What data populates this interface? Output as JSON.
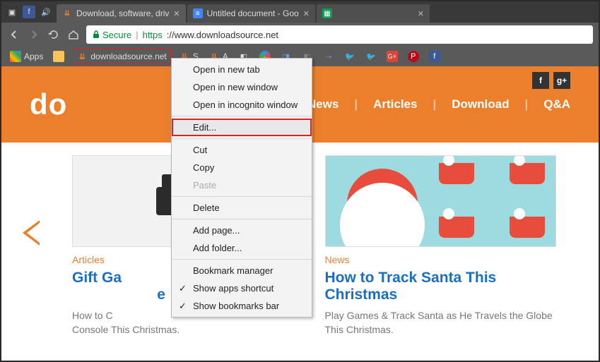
{
  "tabs": [
    {
      "title": "Download, software, driv",
      "icon": "ds"
    },
    {
      "title": "Untitled document - Goo",
      "icon": "doc"
    },
    {
      "title": "",
      "icon": "sheet"
    }
  ],
  "nav": {
    "secure_label": "Secure",
    "url_proto": "https",
    "url_rest": "://www.downloadsource.net"
  },
  "bookmarks": {
    "apps_label": "Apps",
    "highlighted": {
      "label": "downloadsource.net"
    },
    "items": [
      {
        "icon": "ds",
        "label": "S"
      },
      {
        "icon": "ds",
        "label": "A"
      },
      {
        "icon": "g",
        "label": ""
      },
      {
        "icon": "tw",
        "label": ""
      },
      {
        "icon": "tw",
        "label": ""
      },
      {
        "icon": "gp",
        "label": ""
      },
      {
        "icon": "pin",
        "label": ""
      },
      {
        "icon": "fb",
        "label": ""
      }
    ]
  },
  "context_menu": {
    "open_new_tab": "Open in new tab",
    "open_new_window": "Open in new window",
    "open_incognito": "Open in incognito window",
    "edit": "Edit...",
    "cut": "Cut",
    "copy": "Copy",
    "paste": "Paste",
    "delete": "Delete",
    "add_page": "Add page...",
    "add_folder": "Add folder...",
    "bookmark_manager": "Bookmark manager",
    "show_apps": "Show apps shortcut",
    "show_bookmarks": "Show bookmarks bar"
  },
  "site": {
    "logo_text": "do",
    "nav_items": [
      "News",
      "Articles",
      "Download",
      "Q&A"
    ],
    "social_top": [
      "f",
      "g+"
    ]
  },
  "cards": [
    {
      "category": "Articles",
      "title_visible": "Gift Ga",
      "title_suffix": "e",
      "desc_line1": "How to C",
      "desc_line2": "Console This Christmas."
    },
    {
      "category": "News",
      "title": "How to Track Santa This Christmas",
      "desc": "Play Games & Track Santa as He Travels the Globe This Christmas."
    }
  ]
}
